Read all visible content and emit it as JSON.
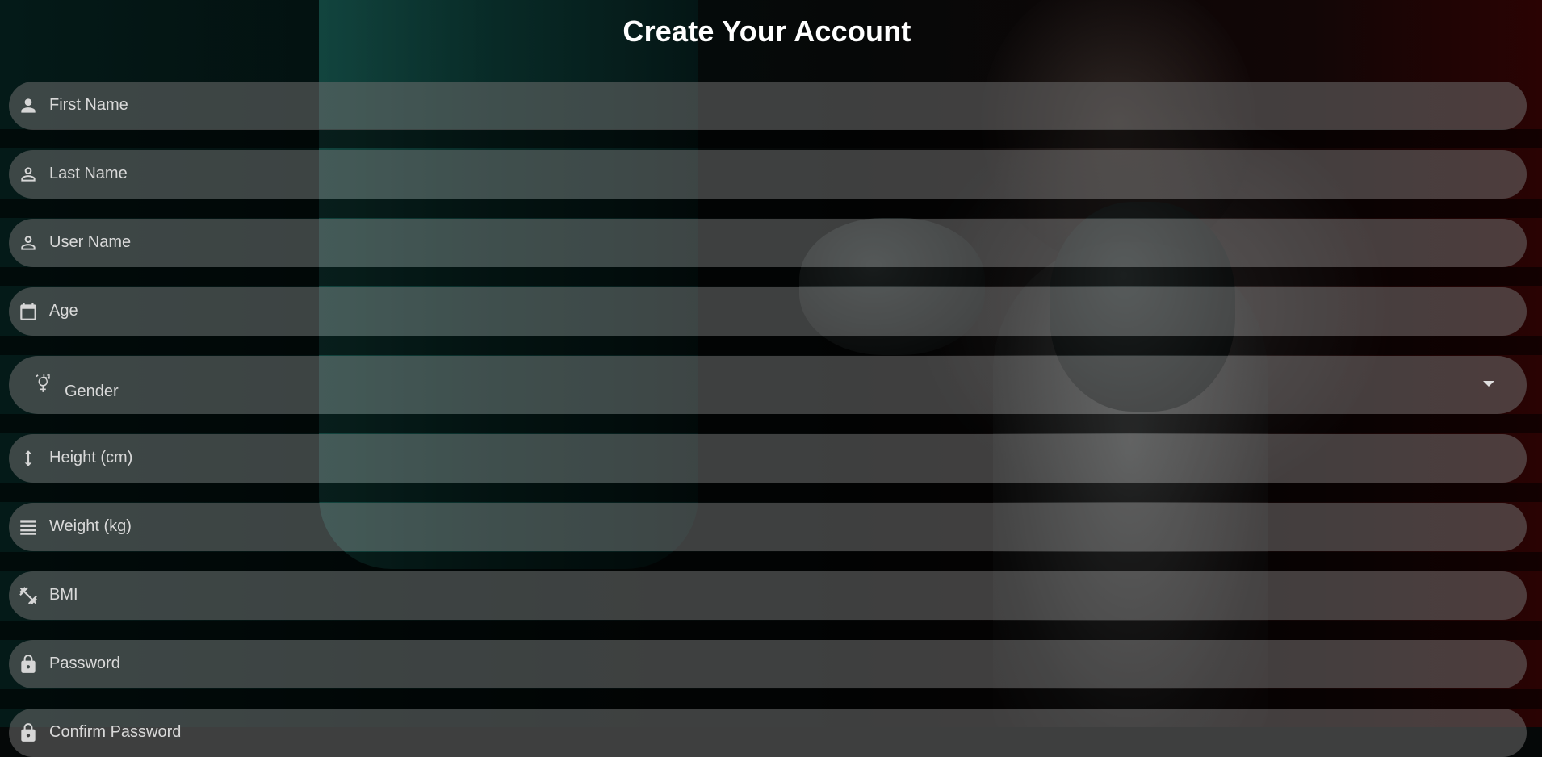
{
  "page": {
    "title": "Create Your Account"
  },
  "form": {
    "fields": [
      {
        "label": "First Name",
        "icon": "person-icon"
      },
      {
        "label": "Last Name",
        "icon": "person-outline-icon"
      },
      {
        "label": "User Name",
        "icon": "person-outline-icon"
      },
      {
        "label": "Age",
        "icon": "calendar-icon"
      },
      {
        "label": "Gender",
        "icon": "gender-icon"
      },
      {
        "label": "Height (cm)",
        "icon": "height-icon"
      },
      {
        "label": "Weight (kg)",
        "icon": "weight-icon"
      },
      {
        "label": "BMI",
        "icon": "fitness-icon"
      },
      {
        "label": "Password",
        "icon": "lock-icon"
      },
      {
        "label": "Confirm Password",
        "icon": "lock-icon"
      }
    ]
  },
  "colors": {
    "title_text": "#ffffff",
    "field_fill": "rgba(110,110,110,0.55)",
    "field_text": "#d9d9d9",
    "icon": "#d6d6d6"
  }
}
